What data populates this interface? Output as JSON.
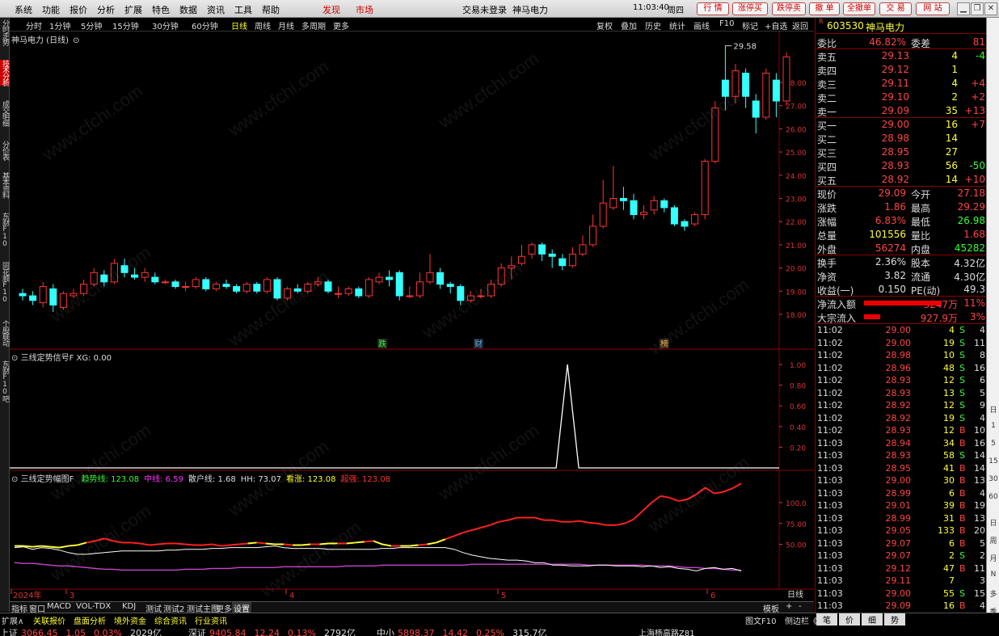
{
  "menu": {
    "items": [
      "系统",
      "功能",
      "报价",
      "分析",
      "扩展",
      "特色",
      "数据",
      "资讯",
      "工具",
      "帮助"
    ],
    "discover": "发现",
    "market": "市场",
    "login_status": "交易未登录",
    "stock_title": "神马电力",
    "clock": "11:03:40",
    "weekday": "周四",
    "buttons": [
      "行 情",
      "涨停买",
      "跌停卖",
      "撤 单",
      "全撤单",
      "交 易",
      "网 站"
    ]
  },
  "left_tabs": [
    "分时走势",
    "技术分析",
    "成交明细",
    "分价表",
    "基本资料",
    "东财F10",
    "同花顺F10",
    "个股联动",
    "东财F10吧"
  ],
  "periods": {
    "items": [
      "分时",
      "1分钟",
      "5分钟",
      "15分钟",
      "30分钟",
      "60分钟",
      "日线",
      "周线",
      "月线",
      "多周期",
      "更多"
    ],
    "selected": "日线",
    "tools": [
      "复权",
      "叠加",
      "历史",
      "统计",
      "画线",
      "F10",
      "标记",
      "+自选",
      "返回"
    ]
  },
  "main_panel": {
    "title": "神马电力 (日线)",
    "peak_label": "29.58",
    "y_ticks": [
      "28.00",
      "27.00",
      "26.00",
      "25.00",
      "24.00",
      "23.00",
      "22.00",
      "21.00",
      "20.00",
      "19.00",
      "18.00"
    ],
    "markers": [
      "跌",
      "财",
      "榜"
    ]
  },
  "signal_panel": {
    "title": "三线定势信号F",
    "value_label": "XG: 0.00",
    "y_ticks": [
      "1.00",
      "0.80",
      "0.60",
      "0.40",
      "0.20"
    ]
  },
  "trend_panel": {
    "title": "三线定势幅图F",
    "legend": [
      {
        "label": "趋势线: 123.08",
        "color": "#3f3"
      },
      {
        "label": "中线: 6.59",
        "color": "#f3f"
      },
      {
        "label": "散户线: 1.68",
        "color": "#ddd"
      },
      {
        "label": "HH: 73.07",
        "color": "#ddd"
      },
      {
        "label": "看涨: 123.08",
        "color": "#ff3"
      },
      {
        "label": "超强: 123.08",
        "color": "#f33"
      }
    ],
    "y_ticks": [
      "100.0",
      "75.00",
      "50.00"
    ]
  },
  "x_axis": {
    "labels": [
      "2024年",
      "3",
      "4",
      "5",
      "6"
    ],
    "period": "日线"
  },
  "bottom_tabs": {
    "items": [
      "指标",
      "窗口",
      "MACD",
      "VOL-TDX",
      "KDJ",
      "测试",
      "测试2",
      "测试主图",
      "更多",
      "设置"
    ],
    "active": "设置",
    "right_items": [
      "模板",
      "+",
      "-"
    ]
  },
  "statusbar": {
    "row1": [
      "扩展∧",
      "关联报价",
      "盘面分析",
      "境外资金",
      "综合资讯",
      "行业资讯"
    ],
    "row1_right": [
      "图文F10",
      "侧边栏《"
    ],
    "indices": [
      {
        "name": "上证",
        "value": "3066.45",
        "chg": "1.05",
        "pct": "0.03%",
        "amt": "2029亿"
      },
      {
        "name": "深证",
        "value": "9405.84",
        "chg": "12.24",
        "pct": "0.13%",
        "amt": "2792亿"
      },
      {
        "name": "中小",
        "value": "5898.37",
        "chg": "14.42",
        "pct": "0.25%",
        "amt": "315.7亿"
      }
    ],
    "broker": "上海杨高路Z81",
    "quote_tabs": [
      "笔",
      "价",
      "细",
      "势"
    ]
  },
  "quote": {
    "code": "603530",
    "name": "神马电力",
    "weibi": {
      "label": "委比",
      "value": "46.82%",
      "label2": "委差",
      "value2": "81"
    },
    "sells": [
      {
        "label": "卖五",
        "price": "29.13",
        "vol": "4",
        "chg": "-4"
      },
      {
        "label": "卖四",
        "price": "29.12",
        "vol": "1",
        "chg": ""
      },
      {
        "label": "卖三",
        "price": "29.11",
        "vol": "4",
        "chg": "+4"
      },
      {
        "label": "卖二",
        "price": "29.10",
        "vol": "2",
        "chg": "+2"
      },
      {
        "label": "卖一",
        "price": "29.09",
        "vol": "35",
        "chg": "+13"
      }
    ],
    "buys": [
      {
        "label": "买一",
        "price": "29.00",
        "vol": "16",
        "chg": "+7"
      },
      {
        "label": "买二",
        "price": "28.98",
        "vol": "14",
        "chg": ""
      },
      {
        "label": "买三",
        "price": "28.95",
        "vol": "27",
        "chg": ""
      },
      {
        "label": "买四",
        "price": "28.93",
        "vol": "56",
        "chg": "-50"
      },
      {
        "label": "买五",
        "price": "28.92",
        "vol": "14",
        "chg": "+10"
      }
    ],
    "stats": [
      {
        "l1": "现价",
        "v1": "29.09",
        "l2": "今开",
        "v2": "27.18"
      },
      {
        "l1": "涨跌",
        "v1": "1.86",
        "l2": "最高",
        "v2": "29.29"
      },
      {
        "l1": "涨幅",
        "v1": "6.83%",
        "l2": "最低",
        "v2": "26.98"
      },
      {
        "l1": "总量",
        "v1": "101556",
        "l2": "量比",
        "v2": "1.68"
      },
      {
        "l1": "外盘",
        "v1": "56274",
        "l2": "内盘",
        "v2": "45282"
      }
    ],
    "stats2": [
      {
        "l1": "换手",
        "v1": "2.36%",
        "l2": "股本",
        "v2": "4.32亿"
      },
      {
        "l1": "净资",
        "v1": "3.82",
        "l2": "流通",
        "v2": "4.30亿"
      },
      {
        "l1": "收益(一)",
        "v1": "0.150",
        "l2": "PE(动)",
        "v2": "49.3"
      }
    ],
    "flows": [
      {
        "label": "净流入额",
        "value": "3247万",
        "pct": "11%"
      },
      {
        "label": "大宗流入",
        "value": "927.9万",
        "pct": "3%"
      }
    ],
    "ticks": [
      {
        "t": "11:02",
        "p": "29.00",
        "v": "4",
        "s": "S",
        "n": "4"
      },
      {
        "t": "11:02",
        "p": "29.00",
        "v": "19",
        "s": "S",
        "n": "11"
      },
      {
        "t": "11:02",
        "p": "28.98",
        "v": "10",
        "s": "S",
        "n": "8"
      },
      {
        "t": "11:02",
        "p": "28.96",
        "v": "48",
        "s": "S",
        "n": "16"
      },
      {
        "t": "11:02",
        "p": "28.93",
        "v": "12",
        "s": "S",
        "n": "6"
      },
      {
        "t": "11:02",
        "p": "28.93",
        "v": "13",
        "s": "S",
        "n": "5"
      },
      {
        "t": "11:02",
        "p": "28.92",
        "v": "12",
        "s": "S",
        "n": "9"
      },
      {
        "t": "11:02",
        "p": "28.92",
        "v": "19",
        "s": "S",
        "n": "4"
      },
      {
        "t": "11:02",
        "p": "28.93",
        "v": "12",
        "s": "B",
        "n": "10"
      },
      {
        "t": "11:03",
        "p": "28.94",
        "v": "34",
        "s": "B",
        "n": "16"
      },
      {
        "t": "11:03",
        "p": "28.93",
        "v": "58",
        "s": "S",
        "n": "14"
      },
      {
        "t": "11:03",
        "p": "28.95",
        "v": "41",
        "s": "B",
        "n": "14"
      },
      {
        "t": "11:03",
        "p": "29.00",
        "v": "30",
        "s": "B",
        "n": "13"
      },
      {
        "t": "11:03",
        "p": "28.99",
        "v": "6",
        "s": "B",
        "n": "4"
      },
      {
        "t": "11:03",
        "p": "29.01",
        "v": "39",
        "s": "B",
        "n": "19"
      },
      {
        "t": "11:03",
        "p": "28.99",
        "v": "31",
        "s": "B",
        "n": "13"
      },
      {
        "t": "11:03",
        "p": "29.05",
        "v": "133",
        "s": "B",
        "n": "20"
      },
      {
        "t": "11:03",
        "p": "29.07",
        "v": "6",
        "s": "B",
        "n": "5"
      },
      {
        "t": "11:03",
        "p": "29.07",
        "v": "2",
        "s": "S",
        "n": "2"
      },
      {
        "t": "11:03",
        "p": "29.12",
        "v": "47",
        "s": "B",
        "n": "11"
      },
      {
        "t": "11:03",
        "p": "29.11",
        "v": "7",
        "s": "",
        "n": "3"
      },
      {
        "t": "11:03",
        "p": "29.00",
        "v": "55",
        "s": "S",
        "n": "15"
      },
      {
        "t": "11:03",
        "p": "29.09",
        "v": "16",
        "s": "B",
        "n": "4"
      }
    ]
  },
  "right_strip": [
    "日",
    "1",
    "5",
    "15",
    "30",
    "60",
    "日",
    "周",
    "月",
    "N",
    "多",
    "季",
    "年"
  ],
  "watermark": "www.cfchi.com",
  "colors": {
    "up": "#ff3333",
    "down": "#33ffff",
    "panel_border": "#8b0000",
    "trend": "#ff2020",
    "retail": "#ffffff",
    "mid": "#cc44cc",
    "yellow": "#ffff33"
  }
}
